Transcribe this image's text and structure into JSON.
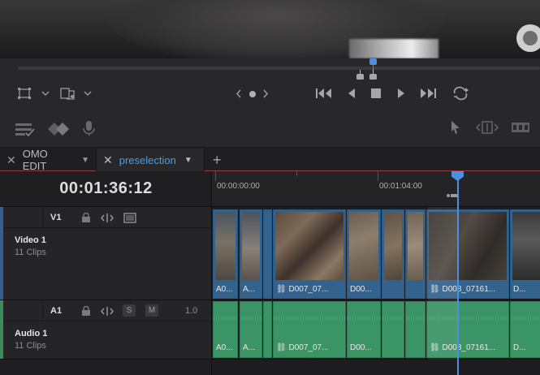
{
  "tabs": [
    {
      "label": "OMO EDIT",
      "active": false
    },
    {
      "label": "preselection",
      "active": true
    }
  ],
  "timecode": "00:01:36:12",
  "ruler": {
    "start_label": "00:00:00:00",
    "mark_label": "00:01:04:00"
  },
  "video_track": {
    "id": "V1",
    "name": "Video 1",
    "clips_label": "11 Clips",
    "clips": [
      {
        "label": "A0...",
        "link": false
      },
      {
        "label": "A...",
        "link": false
      },
      {
        "label": "D007_07...",
        "link": true
      },
      {
        "label": "D00...",
        "link": false
      },
      {
        "label": "",
        "link": false
      },
      {
        "label": "",
        "link": false
      },
      {
        "label": "D008_07161...",
        "link": true
      },
      {
        "label": "D...",
        "link": false
      }
    ]
  },
  "audio_track": {
    "id": "A1",
    "name": "Audio 1",
    "clips_label": "11 Clips",
    "solo_label": "S",
    "mute_label": "M",
    "volume": "1.0",
    "clips": [
      {
        "label": "A0...",
        "link": false
      },
      {
        "label": "A...",
        "link": false
      },
      {
        "label": "D007_07...",
        "link": true
      },
      {
        "label": "D00...",
        "link": false
      },
      {
        "label": "",
        "link": false
      },
      {
        "label": "",
        "link": false
      },
      {
        "label": "D008_07161...",
        "link": true
      },
      {
        "label": "D...",
        "link": false
      }
    ]
  },
  "colors": {
    "accent": "#4a90e2",
    "video_clip": "#33628c",
    "audio_clip": "#3b9466",
    "tab_underline": "#9a3a3a"
  },
  "icons": [
    "crop-icon",
    "chevron-down-icon",
    "transform-icon",
    "prev-icon",
    "dot-icon",
    "next-icon",
    "jump-start-icon",
    "play-reverse-icon",
    "stop-icon",
    "play-icon",
    "jump-end-icon",
    "loop-icon",
    "flags-icon",
    "diamond-icon",
    "microphone-icon",
    "pointer-icon",
    "trim-icon",
    "razor-icon",
    "close-icon",
    "plus-icon",
    "lock-icon",
    "auto-select-icon",
    "film-icon"
  ]
}
